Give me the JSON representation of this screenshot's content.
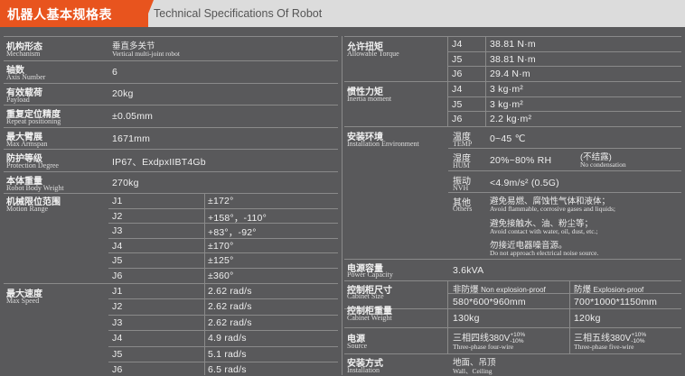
{
  "header": {
    "title_zh": "机器人基本规格表",
    "title_en": "Technical Specifications Of Robot"
  },
  "left": {
    "mechanism": {
      "zh": "机构形态",
      "en": "Mechanism",
      "value_zh": "垂直多关节",
      "value_en": "Vertical multi-joint robot"
    },
    "axes": {
      "zh": "轴数",
      "en": "Axis Number",
      "value": "6"
    },
    "payload": {
      "zh": "有效载荷",
      "en": "Payload",
      "value": "20kg"
    },
    "repeat": {
      "zh": "重复定位精度",
      "en": "Repeat positioning",
      "value": "±0.05mm"
    },
    "armspan": {
      "zh": "最大臂展",
      "en": "Max Armspan",
      "value": "1671mm"
    },
    "protection": {
      "zh": "防护等级",
      "en": "Protection Degree",
      "value": "IP67、ExdpxIIBT4Gb"
    },
    "weight": {
      "zh": "本体重量",
      "en": "Robot Body Weight",
      "value": "270kg"
    },
    "motion": {
      "zh": "机械限位范围",
      "en": "Motion Range",
      "rows": [
        {
          "j": "J1",
          "v": "±172°"
        },
        {
          "j": "J2",
          "v": "+158°，-110°"
        },
        {
          "j": "J3",
          "v": "+83°，-92°"
        },
        {
          "j": "J4",
          "v": "±170°"
        },
        {
          "j": "J5",
          "v": "±125°"
        },
        {
          "j": "J6",
          "v": "±360°"
        }
      ]
    },
    "speed": {
      "zh": "最大速度",
      "en": "Max Speed",
      "rows": [
        {
          "j": "J1",
          "v": "2.62 rad/s"
        },
        {
          "j": "J2",
          "v": "2.62 rad/s"
        },
        {
          "j": "J3",
          "v": "2.62 rad/s"
        },
        {
          "j": "J4",
          "v": "4.9 rad/s"
        },
        {
          "j": "J5",
          "v": "5.1 rad/s"
        },
        {
          "j": "J6",
          "v": "6.5 rad/s"
        }
      ]
    }
  },
  "right": {
    "torque": {
      "zh": "允许扭矩",
      "en": "Allowable Torque",
      "rows": [
        {
          "j": "J4",
          "v": "38.81 N·m"
        },
        {
          "j": "J5",
          "v": "38.81 N·m"
        },
        {
          "j": "J6",
          "v": "29.4 N·m"
        }
      ]
    },
    "inertia": {
      "zh": "惯性力矩",
      "en": "Inertia moment",
      "rows": [
        {
          "j": "J4",
          "v": "3 kg·m²"
        },
        {
          "j": "J5",
          "v": "3 kg·m²"
        },
        {
          "j": "J6",
          "v": "2.2 kg·m²"
        }
      ]
    },
    "env": {
      "zh": "安装环境",
      "en": "Installation Environment",
      "temp_zh": "温度",
      "temp_en": "TEMP",
      "temp_v": "0~45 ℃",
      "hum_zh": "湿度",
      "hum_en": "HUM",
      "hum_v": "20%~80% RH",
      "hum_note_zh": "(不结露)",
      "hum_note_en": "No condensation",
      "vib_zh": "振动",
      "vib_en": "NVH",
      "vib_v": "<4.9m/s² (0.5G)",
      "other_zh": "其他",
      "other_en": "Others",
      "o1_zh": "避免易燃、腐蚀性气体和液体；",
      "o1_en": "Avoid flammable, corrosive gases and liquids;",
      "o2_zh": "避免接触水、油、粉尘等；",
      "o2_en": "Avoid contact with water, oil, dust, etc.;",
      "o3_zh": "勿接近电器噪音源。",
      "o3_en": "Do not approach electrical noise source."
    },
    "power": {
      "zh": "电源容量",
      "en": "Power Capacity",
      "value": "3.6kVA"
    },
    "cab_size": {
      "zh": "控制柜尺寸",
      "en": "Cabinet Size",
      "a": "580*600*960mm",
      "b": "700*1000*1150mm"
    },
    "cab_type": {
      "a_zh": "非防爆",
      "a_en": "Non explosion-proof",
      "b_zh": "防爆",
      "b_en": "Explosion-proof"
    },
    "cab_weight": {
      "zh": "控制柜重量",
      "en": "Cabinet Weight",
      "a": "130kg",
      "b": "120kg"
    },
    "source": {
      "zh": "电源",
      "en": "Source",
      "a_zh": "三相四线380V",
      "b_zh": "三相五线380V",
      "tol_up": "+10%",
      "tol_dn": "-10%",
      "a_en": "Three-phase four-wire",
      "b_en": "Three-phase five-wire"
    },
    "install": {
      "zh": "安装方式",
      "en": "Installation",
      "value_zh": "地面、吊顶",
      "value_en": "Wall、Ceiling"
    }
  }
}
